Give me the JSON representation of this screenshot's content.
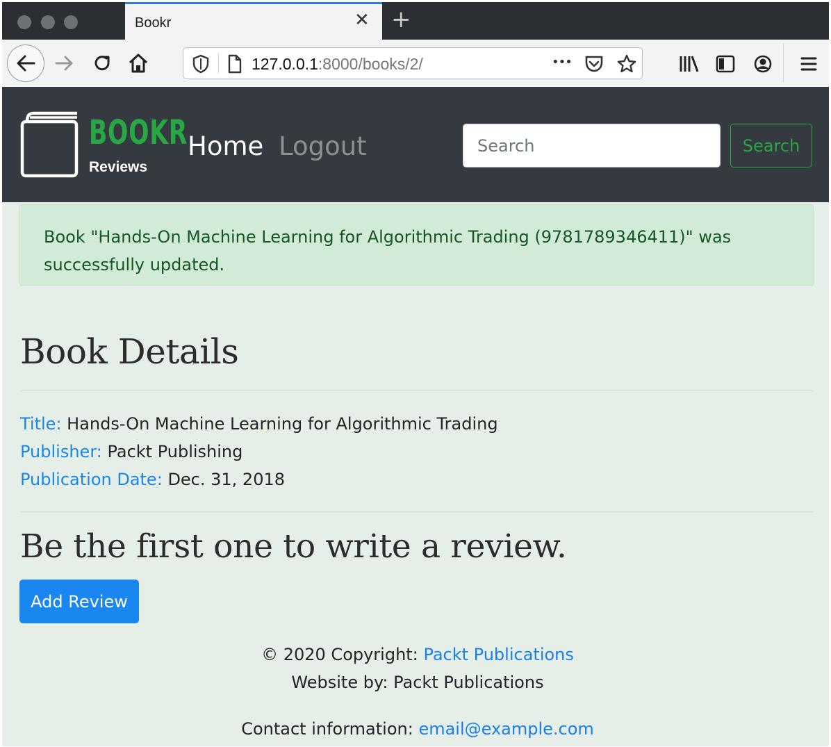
{
  "browser": {
    "tab_title": "Bookr",
    "tab_close_glyph": "✕",
    "new_tab_glyph": "+",
    "url_host": "127.0.0.1",
    "url_path": ":8000/books/2/",
    "page_actions_glyph": "•••",
    "icons": [
      "back-icon",
      "forward-icon",
      "reload-icon",
      "home-icon",
      "shield-icon",
      "page-icon",
      "page-actions-icon",
      "pocket-icon",
      "bookmark-star-icon",
      "library-icon",
      "sidebar-icon",
      "account-icon",
      "menu-icon"
    ]
  },
  "site": {
    "brand_title": "BOOKR",
    "brand_subtitle": "Reviews",
    "nav": {
      "home": "Home",
      "logout": "Logout"
    },
    "search": {
      "placeholder": "Search",
      "button": "Search"
    },
    "colors": {
      "navbar_bg": "#343a40",
      "brand_green": "#28a745",
      "link_blue": "#1a86e6",
      "primary": "#1a86ef"
    }
  },
  "alert": {
    "message": "Book \"Hands-On Machine Learning for Algorithmic Trading (9781789346411)\" was successfully updated."
  },
  "details": {
    "heading": "Book Details",
    "title_label": "Title:",
    "title_value": "Hands-On Machine Learning for Algorithmic Trading",
    "publisher_label": "Publisher:",
    "publisher_value": "Packt Publishing",
    "date_label": "Publication Date:",
    "date_value": "Dec. 31, 2018"
  },
  "reviews": {
    "heading": "Be the first one to write a review.",
    "add_button": "Add Review"
  },
  "footer": {
    "copyright_prefix": "© 2020 Copyright:",
    "copyright_link": "Packt Publications",
    "website_by": "Website by: Packt Publications",
    "contact_prefix": "Contact information:",
    "contact_link": "email@example.com"
  }
}
